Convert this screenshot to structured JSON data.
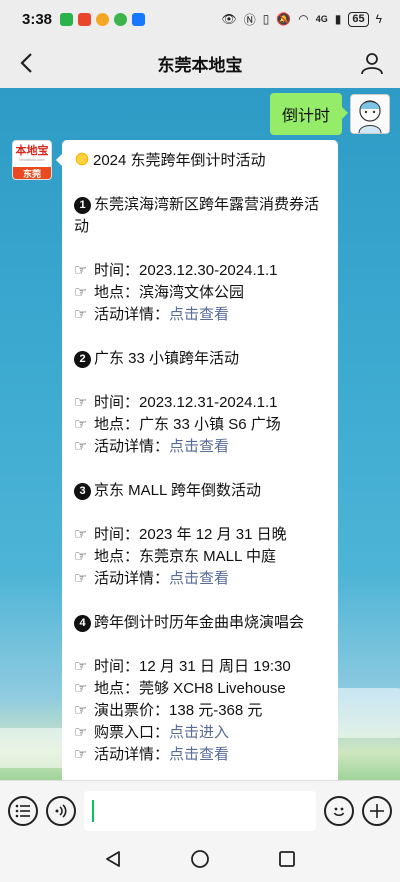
{
  "status_bar": {
    "time": "3:38",
    "network": "4G",
    "battery": "65"
  },
  "nav": {
    "title": "东莞本地宝"
  },
  "outgoing_message": {
    "text": "倒计时"
  },
  "account": {
    "logo_text": "本地宝",
    "logo_sub": "bendibao.com",
    "logo_city": "东莞"
  },
  "incoming_message": {
    "heading": "2024 东莞跨年倒计时活动",
    "labels": {
      "time": "时间：",
      "place": "地点：",
      "details": "活动详情：",
      "price": "演出票价：",
      "ticket": "购票入口："
    },
    "events": [
      {
        "number": "1",
        "title": "东莞滨海湾新区跨年露营消费券活动",
        "time": "2023.12.30-2024.1.1",
        "place": "滨海湾文体公园",
        "details_link": "点击查看"
      },
      {
        "number": "2",
        "title": "广东 33 小镇跨年活动",
        "time": "2023.12.31-2024.1.1",
        "place": "广东 33 小镇 S6 广场",
        "details_link": "点击查看"
      },
      {
        "number": "3",
        "title": "京东 MALL 跨年倒数活动",
        "time": "2023 年 12 月 31 日晚",
        "place": "东莞京东 MALL 中庭",
        "details_link": "点击查看"
      },
      {
        "number": "4",
        "title": "跨年倒计时历年金曲串烧演唱会",
        "time": "12 月 31 日 周日 19:30",
        "place": "莞够 XCH8 Livehouse",
        "price": "138 元-368 元",
        "ticket_link": "点击进入",
        "details_link": "点击查看"
      }
    ]
  },
  "colors": {
    "accent_green": "#95ec69",
    "link": "#576b95",
    "caret": "#07c160",
    "logo_red": "#d8261c"
  }
}
